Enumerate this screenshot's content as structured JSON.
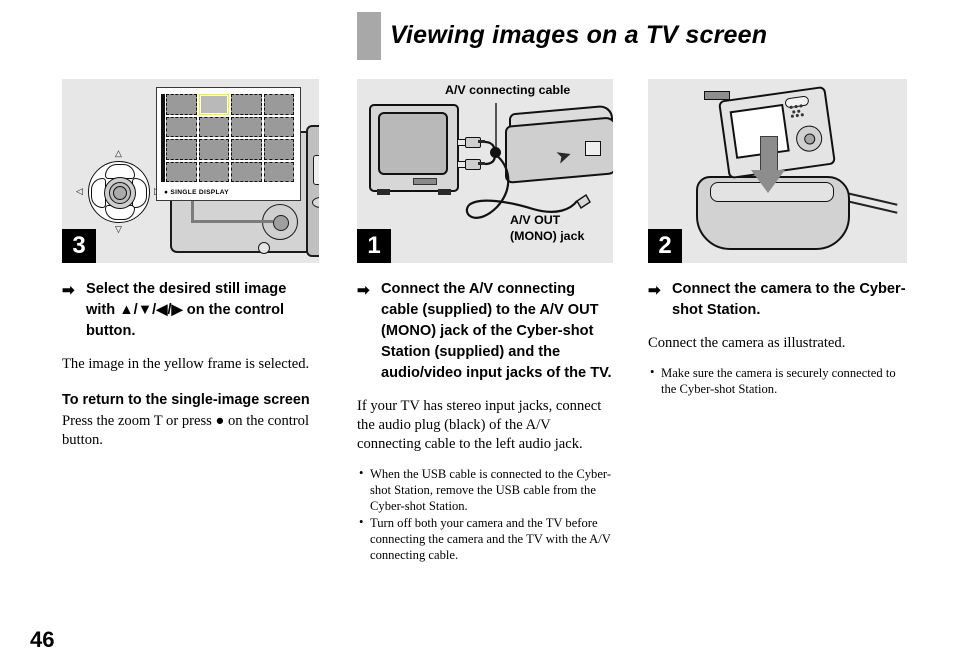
{
  "header": {
    "title": "Viewing images on a TV screen"
  },
  "page_number": "46",
  "arrow_glyph": "➡",
  "bullet_glyph": "•",
  "columns": [
    {
      "id": "left",
      "step_number": "3",
      "figure": {
        "name": "camera-thumbnail-index-screen",
        "lcd_caption": "● SINGLE DISPLAY",
        "pad_arrows": {
          "up": "△",
          "down": "▽",
          "left": "◁",
          "right": "▷"
        }
      },
      "instruction": "Select the desired still image with ▲/▼/◀/▶ on the control button.",
      "paragraph": "The image in the yellow frame is selected.",
      "subhead": "To return to the single-image screen",
      "subhead_paragraph": "Press the zoom T or press ● on the control button.",
      "bullets": []
    },
    {
      "id": "middle",
      "step_number": "1",
      "figure": {
        "name": "tv-and-cyber-shot-station-connection",
        "label_cable": "A/V connecting cable",
        "label_jack_line1": "A/V OUT",
        "label_jack_line2": "(MONO) jack"
      },
      "instruction": "Connect the A/V connecting cable (supplied) to the A/V OUT (MONO) jack of the Cyber-shot Station (supplied) and the audio/video input jacks of the TV.",
      "paragraph": "If your TV has stereo input jacks, connect the audio plug (black) of the A/V connecting cable to the left audio jack.",
      "subhead": "",
      "subhead_paragraph": "",
      "bullets": [
        "When the USB cable is connected to the Cyber-shot Station, remove the USB cable from the Cyber-shot Station.",
        "Turn off both your camera and the TV before connecting the camera and the TV with the A/V connecting cable."
      ]
    },
    {
      "id": "right",
      "step_number": "2",
      "figure": {
        "name": "camera-docking-into-cyber-shot-station"
      },
      "instruction": "Connect the camera to the Cyber-shot Station.",
      "paragraph": "Connect the camera as illustrated.",
      "subhead": "",
      "subhead_paragraph": "",
      "bullets": [
        "Make sure the camera is securely connected to the Cyber-shot Station."
      ]
    }
  ],
  "colors": {
    "figure_background": "#e7e7e7",
    "badge_background": "#000000",
    "badge_text": "#ffffff",
    "title_block": "#a8a8a8",
    "selection_frame": "#f4f400"
  }
}
